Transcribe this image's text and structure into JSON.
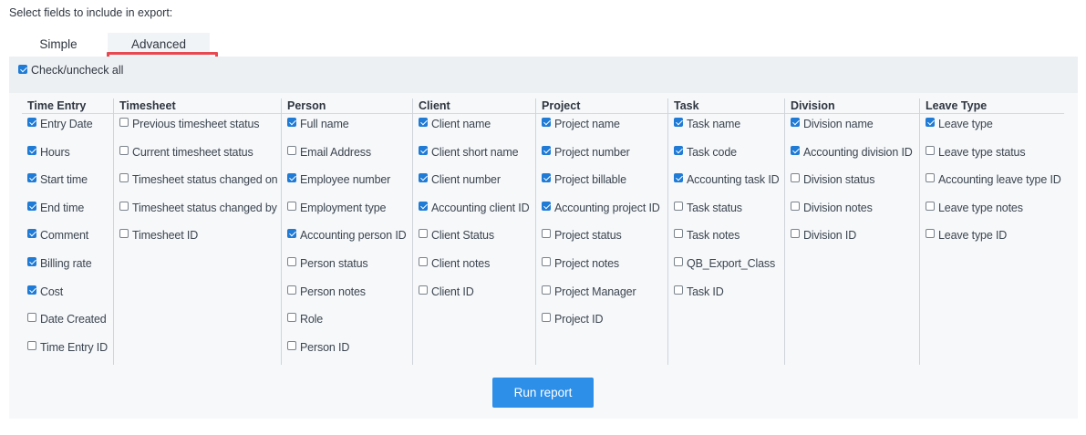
{
  "intro_text": "Select fields to include in export:",
  "tabs": [
    {
      "label": "Simple",
      "selected": false
    },
    {
      "label": "Advanced",
      "selected": true
    }
  ],
  "check_all": {
    "label": "Check/uncheck all",
    "checked": true
  },
  "colors": {
    "checkbox_checked": "#1f7bd6",
    "button": "#2d8fe8",
    "highlight": "#e8484f"
  },
  "columns": [
    {
      "title": "Time Entry",
      "items": [
        {
          "label": "Entry Date",
          "checked": true
        },
        {
          "label": "Hours",
          "checked": true
        },
        {
          "label": "Start time",
          "checked": true
        },
        {
          "label": "End time",
          "checked": true
        },
        {
          "label": "Comment",
          "checked": true
        },
        {
          "label": "Billing rate",
          "checked": true
        },
        {
          "label": "Cost",
          "checked": true
        },
        {
          "label": "Date Created",
          "checked": false
        },
        {
          "label": "Time Entry ID",
          "checked": false
        }
      ]
    },
    {
      "title": "Timesheet",
      "items": [
        {
          "label": "Previous timesheet status",
          "checked": false
        },
        {
          "label": "Current timesheet status",
          "checked": false
        },
        {
          "label": "Timesheet status changed on",
          "checked": false
        },
        {
          "label": "Timesheet status changed by",
          "checked": false
        },
        {
          "label": "Timesheet ID",
          "checked": false
        }
      ]
    },
    {
      "title": "Person",
      "items": [
        {
          "label": "Full name",
          "checked": true
        },
        {
          "label": "Email Address",
          "checked": false
        },
        {
          "label": "Employee number",
          "checked": true
        },
        {
          "label": "Employment type",
          "checked": false
        },
        {
          "label": "Accounting person ID",
          "checked": true
        },
        {
          "label": "Person status",
          "checked": false
        },
        {
          "label": "Person notes",
          "checked": false
        },
        {
          "label": "Role",
          "checked": false
        },
        {
          "label": "Person ID",
          "checked": false
        }
      ]
    },
    {
      "title": "Client",
      "items": [
        {
          "label": "Client name",
          "checked": true
        },
        {
          "label": "Client short name",
          "checked": true
        },
        {
          "label": "Client number",
          "checked": true
        },
        {
          "label": "Accounting client ID",
          "checked": true
        },
        {
          "label": "Client Status",
          "checked": false
        },
        {
          "label": "Client notes",
          "checked": false
        },
        {
          "label": "Client ID",
          "checked": false
        }
      ]
    },
    {
      "title": "Project",
      "items": [
        {
          "label": "Project name",
          "checked": true
        },
        {
          "label": "Project number",
          "checked": true
        },
        {
          "label": "Project billable",
          "checked": true
        },
        {
          "label": "Accounting project ID",
          "checked": true
        },
        {
          "label": "Project status",
          "checked": false
        },
        {
          "label": "Project notes",
          "checked": false
        },
        {
          "label": "Project Manager",
          "checked": false
        },
        {
          "label": "Project ID",
          "checked": false
        }
      ]
    },
    {
      "title": "Task",
      "items": [
        {
          "label": "Task name",
          "checked": true
        },
        {
          "label": "Task code",
          "checked": true
        },
        {
          "label": "Accounting task ID",
          "checked": true
        },
        {
          "label": "Task status",
          "checked": false
        },
        {
          "label": "Task notes",
          "checked": false
        },
        {
          "label": "QB_Export_Class",
          "checked": false
        },
        {
          "label": "Task ID",
          "checked": false
        }
      ]
    },
    {
      "title": "Division",
      "items": [
        {
          "label": "Division name",
          "checked": true
        },
        {
          "label": "Accounting division ID",
          "checked": true
        },
        {
          "label": "Division status",
          "checked": false
        },
        {
          "label": "Division notes",
          "checked": false
        },
        {
          "label": "Division ID",
          "checked": false
        }
      ]
    },
    {
      "title": "Leave Type",
      "items": [
        {
          "label": "Leave type",
          "checked": true
        },
        {
          "label": "Leave type status",
          "checked": false
        },
        {
          "label": "Accounting leave type ID",
          "checked": false
        },
        {
          "label": "Leave type notes",
          "checked": false
        },
        {
          "label": "Leave type ID",
          "checked": false
        }
      ]
    }
  ],
  "run_button": {
    "label": "Run report"
  }
}
